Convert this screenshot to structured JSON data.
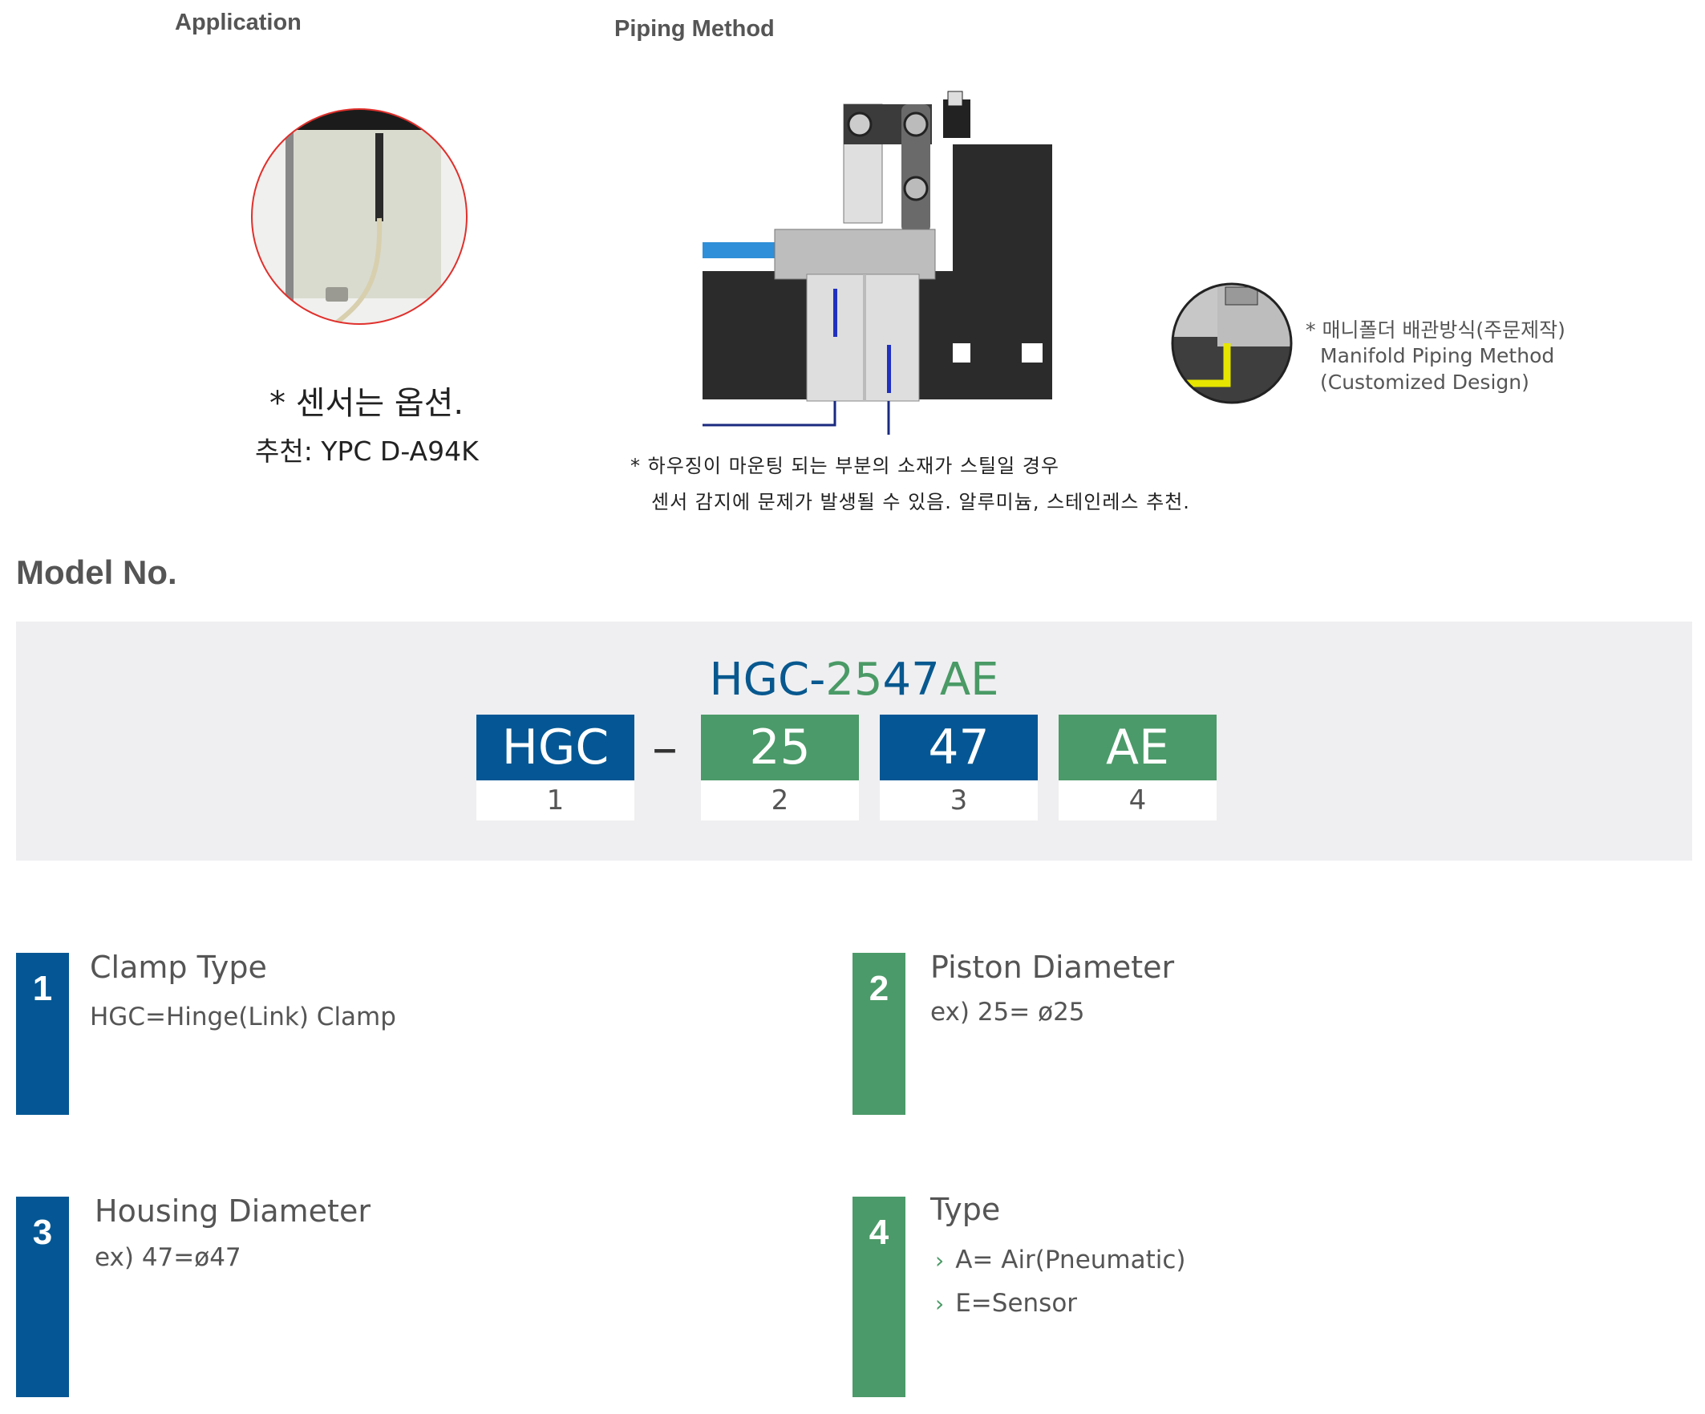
{
  "application": {
    "title": "Application",
    "note_line1": "* 센서는 옵션.",
    "note_line2": "추천: YPC D-A94K"
  },
  "piping": {
    "title": "Piping Method",
    "note_line1": "* 하우징이 마운팅 되는 부분의 소재가 스틸일 경우",
    "note_line2": "센서 감지에 문제가 발생될 수 있음. 알루미늄, 스테인레스 추천."
  },
  "manifold": {
    "line1": "* 매니폴더 배관방식(주문제작)",
    "line2": "Manifold Piping Method",
    "line3": "(Customized Design)"
  },
  "model": {
    "heading": "Model No.",
    "code_part1": "HGC-",
    "code_part2": "25",
    "code_part3": "47",
    "code_part4": "AE",
    "dash": "–",
    "segments": [
      {
        "label": "HGC",
        "num": "1"
      },
      {
        "label": "25",
        "num": "2"
      },
      {
        "label": "47",
        "num": "3"
      },
      {
        "label": "AE",
        "num": "4"
      }
    ]
  },
  "items": [
    {
      "num": "1",
      "title": "Clamp Type",
      "desc": "HGC=Hinge(Link) Clamp"
    },
    {
      "num": "2",
      "title": "Piston Diameter",
      "desc": "ex) 25= ø25"
    },
    {
      "num": "3",
      "title": "Housing Diameter",
      "desc": "ex) 47=ø47"
    },
    {
      "num": "4",
      "title": "Type",
      "opt1": "A= Air(Pneumatic)",
      "opt2": "E=Sensor"
    }
  ],
  "colors": {
    "blue": "#045794",
    "green": "#4b9a69"
  }
}
